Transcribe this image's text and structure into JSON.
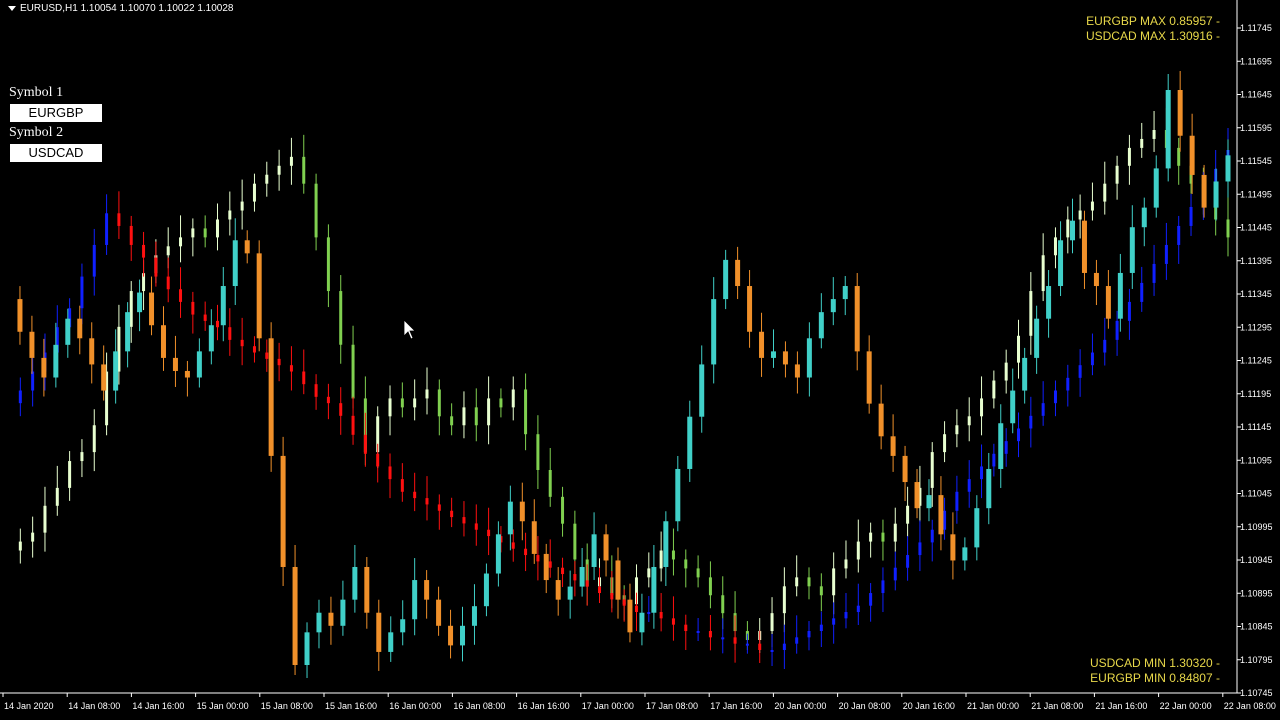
{
  "header": {
    "text": "EURUSD,H1  1.10054 1.10070 1.10022 1.10028"
  },
  "panel": {
    "symbol1_label": "Symbol 1",
    "symbol1_value": "EURGBP",
    "symbol2_label": "Symbol 2",
    "symbol2_value": "USDCAD"
  },
  "info_top": [
    "EURGBP MAX 0.85957 -",
    "USDCAD MAX 1.30916 -"
  ],
  "info_bottom": [
    "USDCAD MIN 1.30320 -",
    "EURGBP MIN 0.84807 -"
  ],
  "colors": {
    "background": "#000000",
    "axis": "#ffffff",
    "info_text": "#e8d84a",
    "eurusd_up": "#40d0c8",
    "eurusd_down": "#f0902a",
    "usdcad_up": "#e8ffd0",
    "usdcad_down": "#80d050",
    "eurgbp_up": "#1020ff",
    "eurgbp_down": "#ff1010"
  },
  "chart_data": {
    "type": "candlestick",
    "symbol": "EURUSD",
    "timeframe": "H1",
    "y_ticks": [
      "1.11745",
      "1.11695",
      "1.11645",
      "1.11595",
      "1.11545",
      "1.11495",
      "1.11445",
      "1.11395",
      "1.11345",
      "1.11295",
      "1.11245",
      "1.11195",
      "1.11145",
      "1.11095",
      "1.11045",
      "1.10995",
      "1.10945",
      "1.10895",
      "1.10845",
      "1.10795",
      "1.10745"
    ],
    "ylim": [
      1.10745,
      1.11745
    ],
    "x_ticks": [
      "14 Jan 2020",
      "14 Jan 08:00",
      "14 Jan 16:00",
      "15 Jan 00:00",
      "15 Jan 08:00",
      "15 Jan 16:00",
      "16 Jan 00:00",
      "16 Jan 08:00",
      "16 Jan 16:00",
      "17 Jan 00:00",
      "17 Jan 08:00",
      "17 Jan 16:00",
      "20 Jan 00:00",
      "20 Jan 08:00",
      "20 Jan 16:00",
      "21 Jan 00:00",
      "21 Jan 08:00",
      "21 Jan 16:00",
      "22 Jan 00:00",
      "22 Jan 08:00"
    ],
    "series": [
      {
        "name": "EURUSD",
        "closes": [
          1.1136,
          1.1131,
          1.1127,
          1.1124,
          1.1129,
          1.1133,
          1.113,
          1.1126,
          1.1122,
          1.1128,
          1.1134,
          1.1137,
          1.1132,
          1.1127,
          1.1125,
          1.1124,
          1.1128,
          1.1132,
          1.1138,
          1.1145,
          1.1143,
          1.113,
          1.1112,
          1.1095,
          1.108,
          1.1085,
          1.1088,
          1.1086,
          1.109,
          1.1095,
          1.1088,
          1.1082,
          1.1085,
          1.1087,
          1.1093,
          1.109,
          1.1086,
          1.1083,
          1.1086,
          1.1089,
          1.1094,
          1.11,
          1.1105,
          1.1102,
          1.1097,
          1.1093,
          1.109,
          1.1092,
          1.1095,
          1.11,
          1.1096,
          1.109,
          1.1085,
          1.1088,
          1.1095,
          1.1102,
          1.111,
          1.1118,
          1.1126,
          1.1136,
          1.1142,
          1.1138,
          1.1131,
          1.1127,
          1.1128,
          1.1126,
          1.1124,
          1.113,
          1.1134,
          1.1136,
          1.1138,
          1.1128,
          1.112,
          1.1115,
          1.1112,
          1.1108,
          1.1104,
          1.1106,
          1.11,
          1.1096,
          1.1098,
          1.1104,
          1.111,
          1.1117,
          1.1122,
          1.1127,
          1.1133,
          1.1138,
          1.1145,
          1.1148,
          1.114,
          1.1138,
          1.1133,
          1.114,
          1.1147,
          1.115,
          1.1156,
          1.1168,
          1.1161,
          1.1155,
          1.115,
          1.1154,
          1.1158
        ]
      },
      {
        "name": "USDCAD",
        "closes": [
          1.3045,
          1.3046,
          1.3047,
          1.305,
          1.3052,
          1.3055,
          1.3056,
          1.3059,
          1.3065,
          1.307,
          1.3074,
          1.3076,
          1.3078,
          1.3079,
          1.308,
          1.3081,
          1.308,
          1.3082,
          1.3083,
          1.3084,
          1.3086,
          1.3087,
          1.3088,
          1.3089,
          1.3086,
          1.308,
          1.3074,
          1.3068,
          1.3062,
          1.3056,
          1.306,
          1.3062,
          1.3061,
          1.3062,
          1.3063,
          1.306,
          1.3059,
          1.3061,
          1.3059,
          1.3062,
          1.3061,
          1.3063,
          1.3058,
          1.3054,
          1.3051,
          1.3048,
          1.3044,
          1.3041,
          1.3042,
          1.304,
          1.3039,
          1.3042,
          1.3043,
          1.3045,
          1.3044,
          1.3043,
          1.3042,
          1.304,
          1.3038,
          1.3036,
          1.3035,
          1.3036,
          1.3038,
          1.3041,
          1.3042,
          1.3041,
          1.304,
          1.3043,
          1.3044,
          1.3046,
          1.3047,
          1.3046,
          1.3048,
          1.305,
          1.3052,
          1.3056,
          1.3058,
          1.3059,
          1.306,
          1.3062,
          1.3064,
          1.3066,
          1.3069,
          1.3074,
          1.3078,
          1.308,
          1.3082,
          1.3083,
          1.3084,
          1.3086,
          1.3088,
          1.309,
          1.3091,
          1.3092,
          1.309,
          1.3088,
          1.3086,
          1.3084,
          1.3082,
          1.308
        ]
      },
      {
        "name": "EURGBP",
        "closes": [
          0.852,
          0.8522,
          0.8525,
          0.8528,
          0.8532,
          0.8535,
          0.854,
          0.8545,
          0.855,
          0.8548,
          0.8545,
          0.8543,
          0.854,
          0.8538,
          0.8536,
          0.8534,
          0.8533,
          0.8532,
          0.853,
          0.8529,
          0.8528,
          0.8527,
          0.8526,
          0.8525,
          0.8523,
          0.8521,
          0.852,
          0.8518,
          0.8515,
          0.8512,
          0.851,
          0.8508,
          0.8506,
          0.8505,
          0.8504,
          0.8503,
          0.8502,
          0.8501,
          0.85,
          0.8499,
          0.8498,
          0.8497,
          0.8496,
          0.8495,
          0.8494,
          0.8493,
          0.8492,
          0.8491,
          0.849,
          0.8489,
          0.8488,
          0.8487,
          0.8487,
          0.8486,
          0.8485,
          0.8484,
          0.8484,
          0.8483,
          0.8483,
          0.8482,
          0.8482,
          0.8481,
          0.8481,
          0.8482,
          0.8483,
          0.8484,
          0.8485,
          0.8486,
          0.8487,
          0.8488,
          0.849,
          0.8492,
          0.8494,
          0.8496,
          0.8498,
          0.85,
          0.8503,
          0.8506,
          0.8508,
          0.851,
          0.8512,
          0.8514,
          0.8516,
          0.8518,
          0.852,
          0.8522,
          0.8524,
          0.8526,
          0.8528,
          0.853,
          0.8533,
          0.8536,
          0.8539,
          0.8542,
          0.8545,
          0.8548,
          0.8551,
          0.8554,
          0.8557,
          0.856
        ]
      }
    ],
    "grid": false
  }
}
